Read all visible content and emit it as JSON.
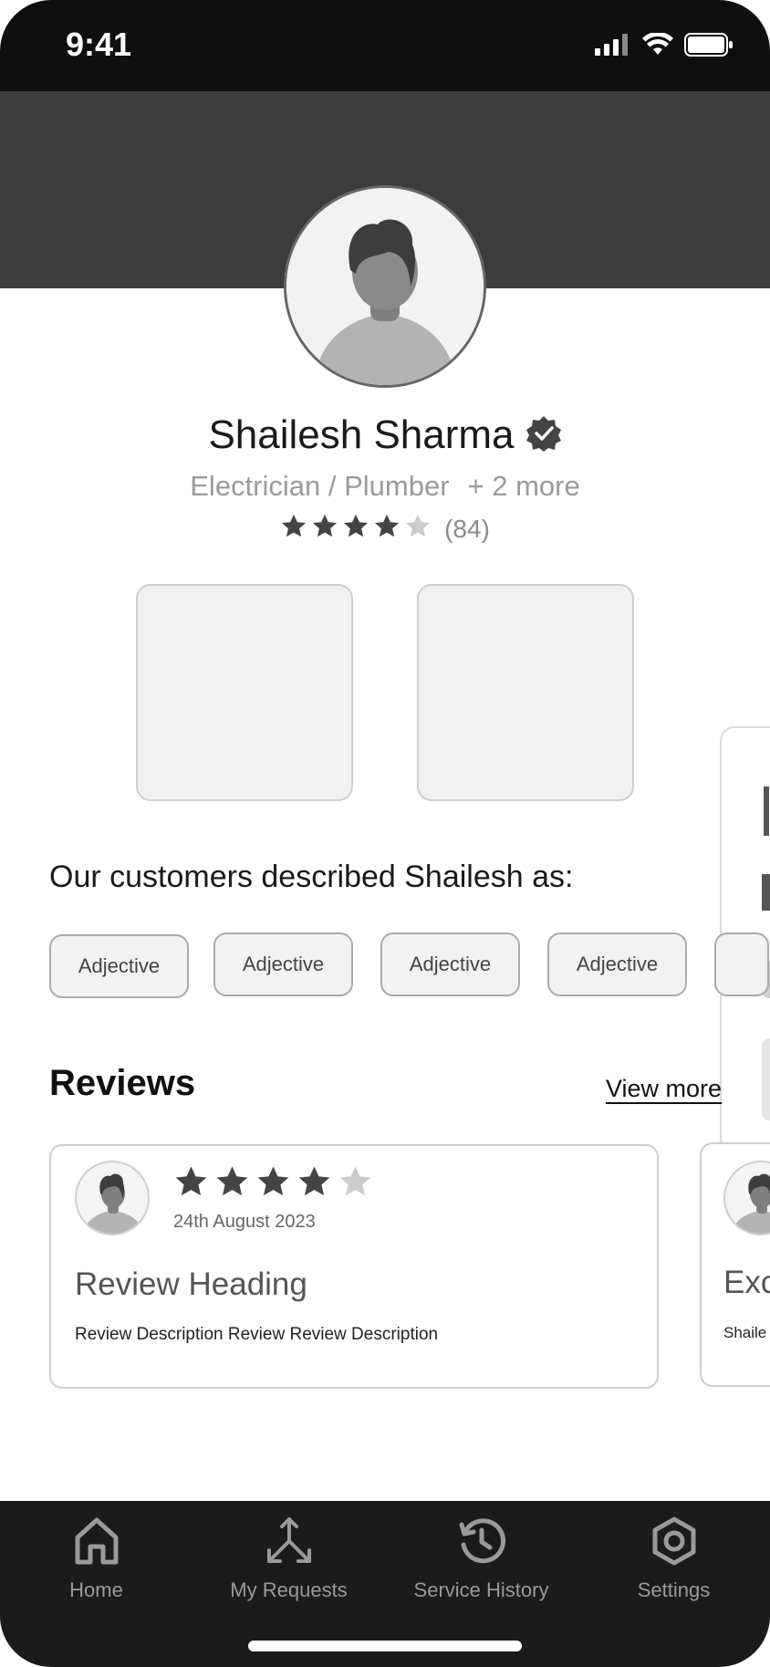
{
  "status_bar": {
    "time": "9:41",
    "icons": [
      "cellular-icon",
      "wifi-icon",
      "battery-icon"
    ]
  },
  "profile": {
    "name": "Shailesh Sharma",
    "verified_icon": "verified-badge-icon",
    "profession": "Electrician / Plumber",
    "more_professions": "+ 2 more",
    "rating": {
      "stars_filled": 4,
      "stars_total": 5,
      "count": "(84)"
    }
  },
  "described": {
    "title": "Our customers described Shailesh as:",
    "chips": [
      "Adjective",
      "Adjective",
      "Adjective",
      "Adjective"
    ]
  },
  "reviews": {
    "title": "Reviews",
    "view_more": "View more",
    "items": [
      {
        "stars_filled": 4,
        "stars_total": 5,
        "date": "24th August 2023",
        "heading": "Review Heading",
        "description": "Review Description Review Review Description"
      },
      {
        "heading": "Exc",
        "description": "Shaile truly k"
      }
    ]
  },
  "nav": {
    "items": [
      {
        "label": "Home",
        "icon": "home-icon"
      },
      {
        "label": "My Requests",
        "icon": "requests-icon"
      },
      {
        "label": "Service History",
        "icon": "history-icon"
      },
      {
        "label": "Settings",
        "icon": "settings-icon"
      }
    ]
  },
  "colors": {
    "header_band": "#3c3c3c",
    "status_bar": "#0f0f0f",
    "nav_bar": "#1b1b1b",
    "star_filled": "#444444",
    "star_empty": "#cccccc"
  }
}
